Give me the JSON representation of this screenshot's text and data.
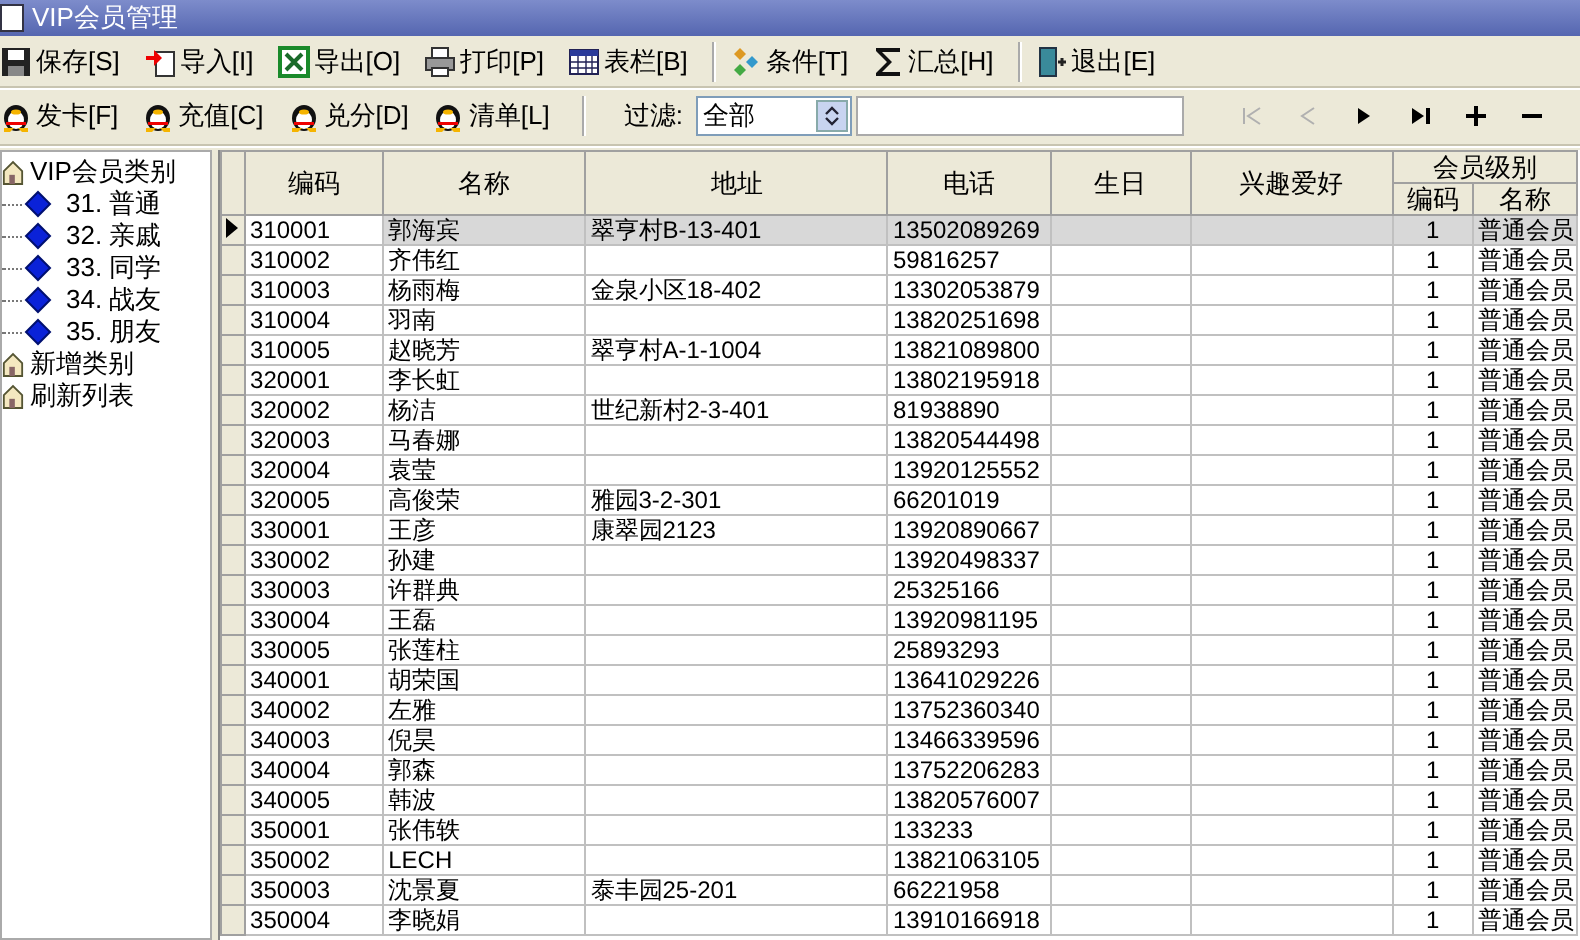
{
  "window": {
    "title": "VIP会员管理"
  },
  "toolbar": [
    [
      {
        "label": "保存[S]",
        "kind": "save"
      },
      {
        "label": "导入[I]",
        "kind": "import"
      },
      {
        "label": "导出[O]",
        "kind": "export"
      },
      {
        "label": "打印[P]",
        "kind": "print"
      },
      {
        "label": "表栏[B]",
        "kind": "grid"
      }
    ],
    [
      {
        "label": "条件[T]",
        "kind": "filter"
      },
      {
        "label": "汇总[H]",
        "kind": "sum"
      }
    ],
    [
      {
        "label": "退出[E]",
        "kind": "exit"
      }
    ]
  ],
  "toolbar2": [
    {
      "label": "发卡[F]"
    },
    {
      "label": "充值[C]"
    },
    {
      "label": "兑分[D]"
    },
    {
      "label": "清单[L]"
    }
  ],
  "filter": {
    "label": "过滤:",
    "value": "全部"
  },
  "nav": [
    {
      "kind": "first",
      "disabled": true
    },
    {
      "kind": "prev",
      "disabled": true
    },
    {
      "kind": "next",
      "disabled": false
    },
    {
      "kind": "last",
      "disabled": false
    },
    {
      "kind": "add",
      "disabled": false
    },
    {
      "kind": "remove",
      "disabled": false
    }
  ],
  "tree": [
    {
      "label": "VIP会员类别",
      "expanded": true,
      "children": [
        {
          "label": "31. 普通"
        },
        {
          "label": "32. 亲戚"
        },
        {
          "label": "33. 同学"
        },
        {
          "label": "34. 战友"
        },
        {
          "label": "35. 朋友"
        }
      ]
    },
    {
      "label": "新增类别"
    },
    {
      "label": "刷新列表"
    }
  ],
  "table": {
    "columns": [
      "编码",
      "名称",
      "地址",
      "电话",
      "生日",
      "兴趣爱好"
    ],
    "group": {
      "label": "会员级别",
      "columns": [
        "编码",
        "名称"
      ]
    },
    "rows": [
      {
        "selected": true,
        "cells": [
          "310001",
          "郭海宾",
          "翠亨村B-13-401",
          "13502089269",
          "",
          "",
          "1",
          "普通会员"
        ]
      },
      {
        "selected": false,
        "cells": [
          "310002",
          "齐伟红",
          "",
          "59816257",
          "",
          "",
          "1",
          "普通会员"
        ]
      },
      {
        "selected": false,
        "cells": [
          "310003",
          "杨雨梅",
          "金泉小区18-402",
          "13302053879",
          "",
          "",
          "1",
          "普通会员"
        ]
      },
      {
        "selected": false,
        "cells": [
          "310004",
          "羽南",
          "",
          "13820251698",
          "",
          "",
          "1",
          "普通会员"
        ]
      },
      {
        "selected": false,
        "cells": [
          "310005",
          "赵晓芳",
          "翠亨村A-1-1004",
          "13821089800",
          "",
          "",
          "1",
          "普通会员"
        ]
      },
      {
        "selected": false,
        "cells": [
          "320001",
          "李长虹",
          "",
          "13802195918",
          "",
          "",
          "1",
          "普通会员"
        ]
      },
      {
        "selected": false,
        "cells": [
          "320002",
          "杨洁",
          "世纪新村2-3-401",
          "81938890",
          "",
          "",
          "1",
          "普通会员"
        ]
      },
      {
        "selected": false,
        "cells": [
          "320003",
          "马春娜",
          "",
          "13820544498",
          "",
          "",
          "1",
          "普通会员"
        ]
      },
      {
        "selected": false,
        "cells": [
          "320004",
          "袁莹",
          "",
          "13920125552",
          "",
          "",
          "1",
          "普通会员"
        ]
      },
      {
        "selected": false,
        "cells": [
          "320005",
          "高俊荣",
          "雅园3-2-301",
          "66201019",
          "",
          "",
          "1",
          "普通会员"
        ]
      },
      {
        "selected": false,
        "cells": [
          "330001",
          "王彦",
          "康翠园2123",
          "13920890667",
          "",
          "",
          "1",
          "普通会员"
        ]
      },
      {
        "selected": false,
        "cells": [
          "330002",
          "孙建",
          "",
          "13920498337",
          "",
          "",
          "1",
          "普通会员"
        ]
      },
      {
        "selected": false,
        "cells": [
          "330003",
          "许群典",
          "",
          "25325166",
          "",
          "",
          "1",
          "普通会员"
        ]
      },
      {
        "selected": false,
        "cells": [
          "330004",
          "王磊",
          "",
          "13920981195",
          "",
          "",
          "1",
          "普通会员"
        ]
      },
      {
        "selected": false,
        "cells": [
          "330005",
          "张莲柱",
          "",
          "25893293",
          "",
          "",
          "1",
          "普通会员"
        ]
      },
      {
        "selected": false,
        "cells": [
          "340001",
          "胡荣国",
          "",
          "13641029226",
          "",
          "",
          "1",
          "普通会员"
        ]
      },
      {
        "selected": false,
        "cells": [
          "340002",
          "左雅",
          "",
          "13752360340",
          "",
          "",
          "1",
          "普通会员"
        ]
      },
      {
        "selected": false,
        "cells": [
          "340003",
          "倪昊",
          "",
          "13466339596",
          "",
          "",
          "1",
          "普通会员"
        ]
      },
      {
        "selected": false,
        "cells": [
          "340004",
          "郭森",
          "",
          "13752206283",
          "",
          "",
          "1",
          "普通会员"
        ]
      },
      {
        "selected": false,
        "cells": [
          "340005",
          "韩波",
          "",
          "13820576007",
          "",
          "",
          "1",
          "普通会员"
        ]
      },
      {
        "selected": false,
        "cells": [
          "350001",
          "张伟轶",
          "",
          "133233",
          "",
          "",
          "1",
          "普通会员"
        ]
      },
      {
        "selected": false,
        "cells": [
          "350002",
          "LECH",
          "",
          "13821063105",
          "",
          "",
          "1",
          "普通会员"
        ]
      },
      {
        "selected": false,
        "cells": [
          "350003",
          "沈景夏",
          "泰丰园25-201",
          "66221958",
          "",
          "",
          "1",
          "普通会员"
        ]
      },
      {
        "selected": false,
        "cells": [
          "350004",
          "李晓娟",
          "",
          "13910166918",
          "",
          "",
          "1",
          "普通会员"
        ]
      }
    ]
  }
}
